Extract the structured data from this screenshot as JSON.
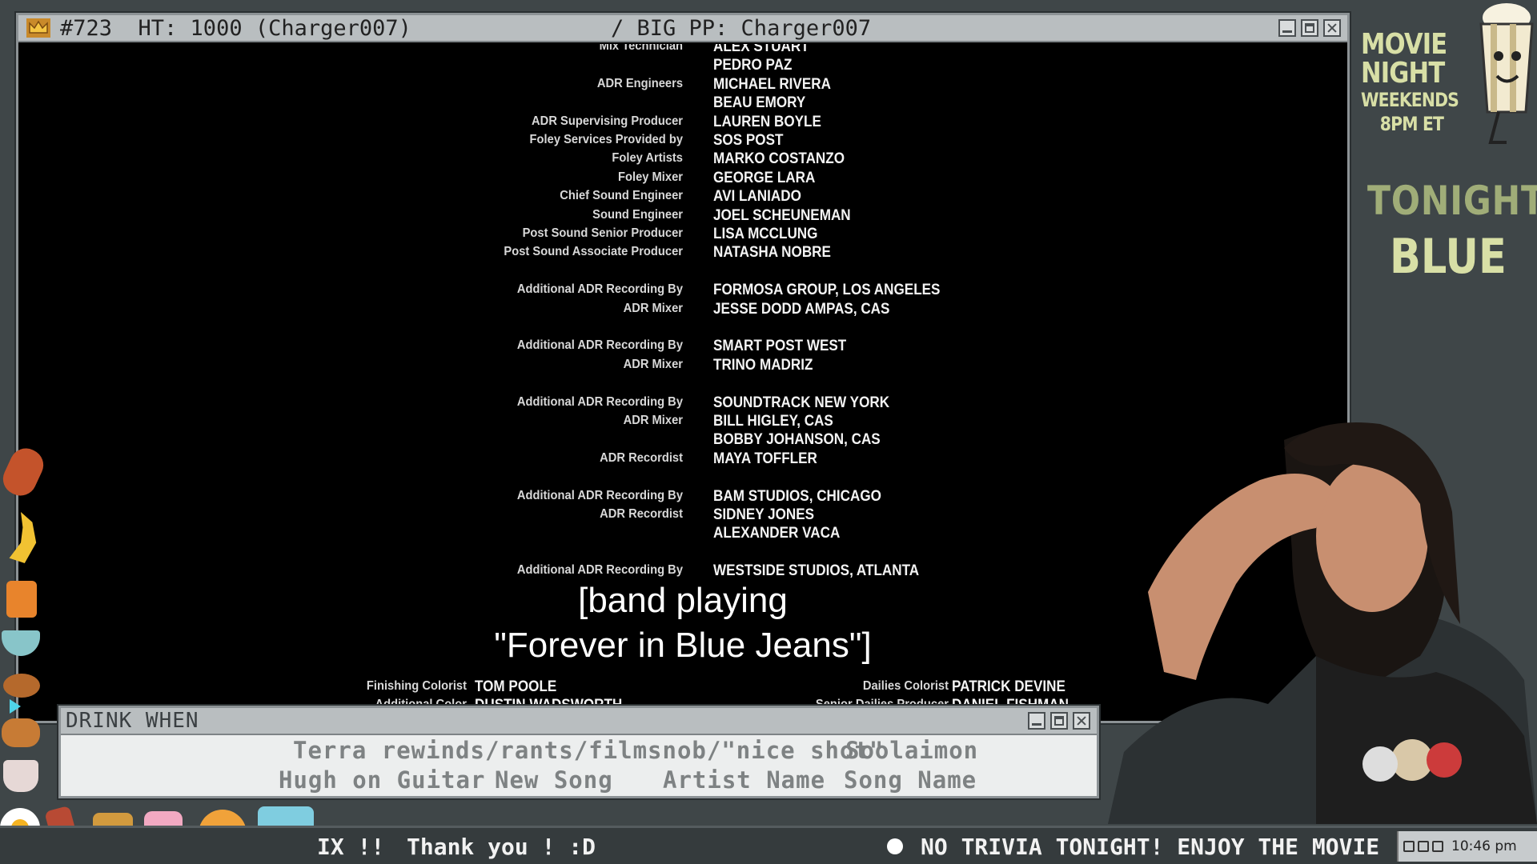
{
  "main_window": {
    "title_left": "#723  HT: 1000 (Charger007)",
    "title_center": "/ BIG PP: Charger007"
  },
  "credits": [
    {
      "role": "Mix Technician",
      "names": [
        "ALEX STUART",
        "PEDRO PAZ"
      ]
    },
    {
      "role": "ADR Engineers",
      "names": [
        "MICHAEL RIVERA",
        "BEAU EMORY"
      ]
    },
    {
      "role": "ADR Supervising Producer",
      "names": [
        "LAUREN BOYLE"
      ]
    },
    {
      "role": "Foley Services Provided by",
      "names": [
        "SOS POST"
      ]
    },
    {
      "role": "Foley Artists",
      "names": [
        "MARKO COSTANZO"
      ]
    },
    {
      "role": "Foley Mixer",
      "names": [
        "GEORGE LARA"
      ]
    },
    {
      "role": "Chief Sound Engineer",
      "names": [
        "AVI LANIADO"
      ]
    },
    {
      "role": "Sound Engineer",
      "names": [
        "JOEL SCHEUNEMAN"
      ]
    },
    {
      "role": "Post Sound Senior Producer",
      "names": [
        "LISA MCCLUNG"
      ]
    },
    {
      "role": "Post Sound Associate Producer",
      "names": [
        "NATASHA NOBRE"
      ]
    },
    {
      "role": "Additional ADR Recording By",
      "names": [
        "FORMOSA GROUP, LOS ANGELES"
      ]
    },
    {
      "role": "ADR Mixer",
      "names": [
        "JESSE DODD AMPAS, CAS"
      ]
    },
    {
      "role": "Additional ADR Recording By",
      "names": [
        "SMART POST WEST"
      ]
    },
    {
      "role": "ADR Mixer",
      "names": [
        "TRINO MADRIZ"
      ]
    },
    {
      "role": "Additional ADR Recording By",
      "names": [
        "SOUNDTRACK NEW YORK"
      ]
    },
    {
      "role": "ADR Mixer",
      "names": [
        "BILL HIGLEY, CAS",
        "BOBBY JOHANSON, CAS"
      ]
    },
    {
      "role": "ADR Recordist",
      "names": [
        "MAYA TOFFLER"
      ]
    },
    {
      "role": "Additional ADR Recording By",
      "names": [
        "BAM STUDIOS, CHICAGO"
      ]
    },
    {
      "role": "ADR Recordist",
      "names": [
        "SIDNEY JONES",
        "ALEXANDER VACA"
      ]
    },
    {
      "role": "Additional ADR Recording By",
      "names": [
        "WESTSIDE STUDIOS, ATLANTA"
      ]
    }
  ],
  "credits_bottom": {
    "left": [
      {
        "role": "Finishing Colorist",
        "name": "TOM POOLE"
      },
      {
        "role": "Additional Color",
        "name": "DUSTIN WADSWORTH"
      }
    ],
    "right": [
      {
        "role": "Dailies Colorist",
        "name": "PATRICK DEVINE"
      },
      {
        "role": "Senior Dailies Producer",
        "name": "DANIEL FISHMAN"
      }
    ]
  },
  "subtitle": {
    "line1": "[band playing",
    "line2": "\"Forever in Blue Jeans\"]"
  },
  "drink_window": {
    "title": "DRINK WHEN",
    "items": [
      "Terra rewinds/rants/filmsnob/\"nice shot\"",
      "Soolaimon",
      "Hugh on Guitar",
      "New Song",
      "Artist Name",
      "Song Name"
    ]
  },
  "ticker": {
    "left_fragment": "IX !!",
    "thanks": "Thank you ! :D",
    "announcement": "NO TRIVIA TONIGHT! ENJOY THE MOVIE",
    "clock": "10:46 pm"
  },
  "side_panel": {
    "movie": "MOVIE",
    "night": "NIGHT",
    "weekends": "WEEKENDS",
    "time": "8PM ET",
    "tonight": "TONIGHT:",
    "tonight_title": "BLUE"
  },
  "colors": {
    "frame": "#3f4648",
    "titlebar": "#b9bec0",
    "accent_text": "#d8dfa6",
    "drink_text": "#7e8283"
  },
  "icons": [
    "crown-icon",
    "minimize-icon",
    "maximize-icon",
    "close-icon",
    "popcorn-mascot-icon",
    "emote-icons",
    "tray-icons"
  ]
}
